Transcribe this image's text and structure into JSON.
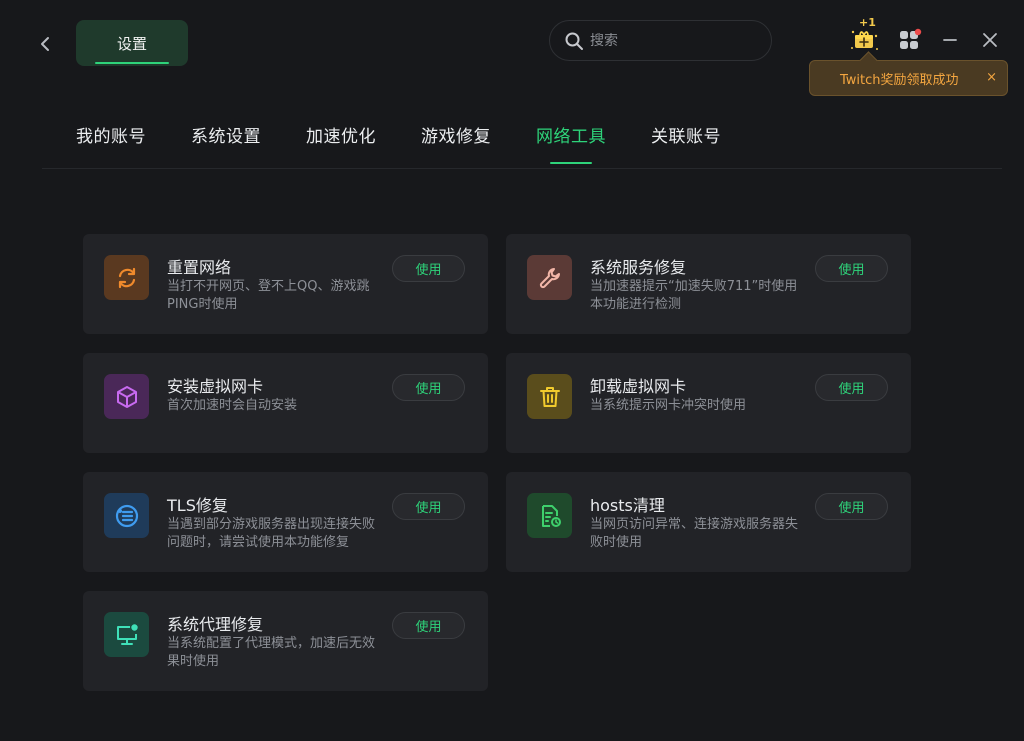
{
  "header": {
    "settings_label": "设置",
    "search_placeholder": "搜索",
    "reward_badge": "+1"
  },
  "toast": {
    "message": "Twitch奖励领取成功",
    "close": "×"
  },
  "tabs": [
    {
      "label": "我的账号",
      "active": false
    },
    {
      "label": "系统设置",
      "active": false
    },
    {
      "label": "加速优化",
      "active": false
    },
    {
      "label": "游戏修复",
      "active": false
    },
    {
      "label": "网络工具",
      "active": true
    },
    {
      "label": "关联账号",
      "active": false
    }
  ],
  "tools": [
    {
      "title": "重置网络",
      "desc": "当打不开网页、登不上QQ、游戏跳PING时使用",
      "button": "使用",
      "icon": "refresh-icon",
      "icon_color": "#f08a2c",
      "icon_bg": "#5a3920"
    },
    {
      "title": "系统服务修复",
      "desc": "当加速器提示“加速失败711”时使用本功能进行检测",
      "button": "使用",
      "icon": "wrench-icon",
      "icon_color": "#f2b6a8",
      "icon_bg": "#5b3a36"
    },
    {
      "title": "安装虚拟网卡",
      "desc": "首次加速时会自动安装",
      "button": "使用",
      "icon": "cube-icon",
      "icon_color": "#c86af0",
      "icon_bg": "#4a2858"
    },
    {
      "title": "卸载虚拟网卡",
      "desc": "当系统提示网卡冲突时使用",
      "button": "使用",
      "icon": "trash-icon",
      "icon_color": "#f1cb2d",
      "icon_bg": "#5a4d1c"
    },
    {
      "title": "TLS修复",
      "desc": "当遇到部分游戏服务器出现连接失败问题时，请尝试使用本功能修复",
      "button": "使用",
      "icon": "tls-icon",
      "icon_color": "#3f9cf0",
      "icon_bg": "#1f3b5a"
    },
    {
      "title": "hosts清理",
      "desc": "当网页访问异常、连接游戏服务器失败时使用",
      "button": "使用",
      "icon": "file-clean-icon",
      "icon_color": "#3ed06c",
      "icon_bg": "#1f4a2c"
    },
    {
      "title": "系统代理修复",
      "desc": "当系统配置了代理模式，加速后无效果时使用",
      "button": "使用",
      "icon": "monitor-icon",
      "icon_color": "#3fe0b8",
      "icon_bg": "#1b4a3f"
    }
  ]
}
